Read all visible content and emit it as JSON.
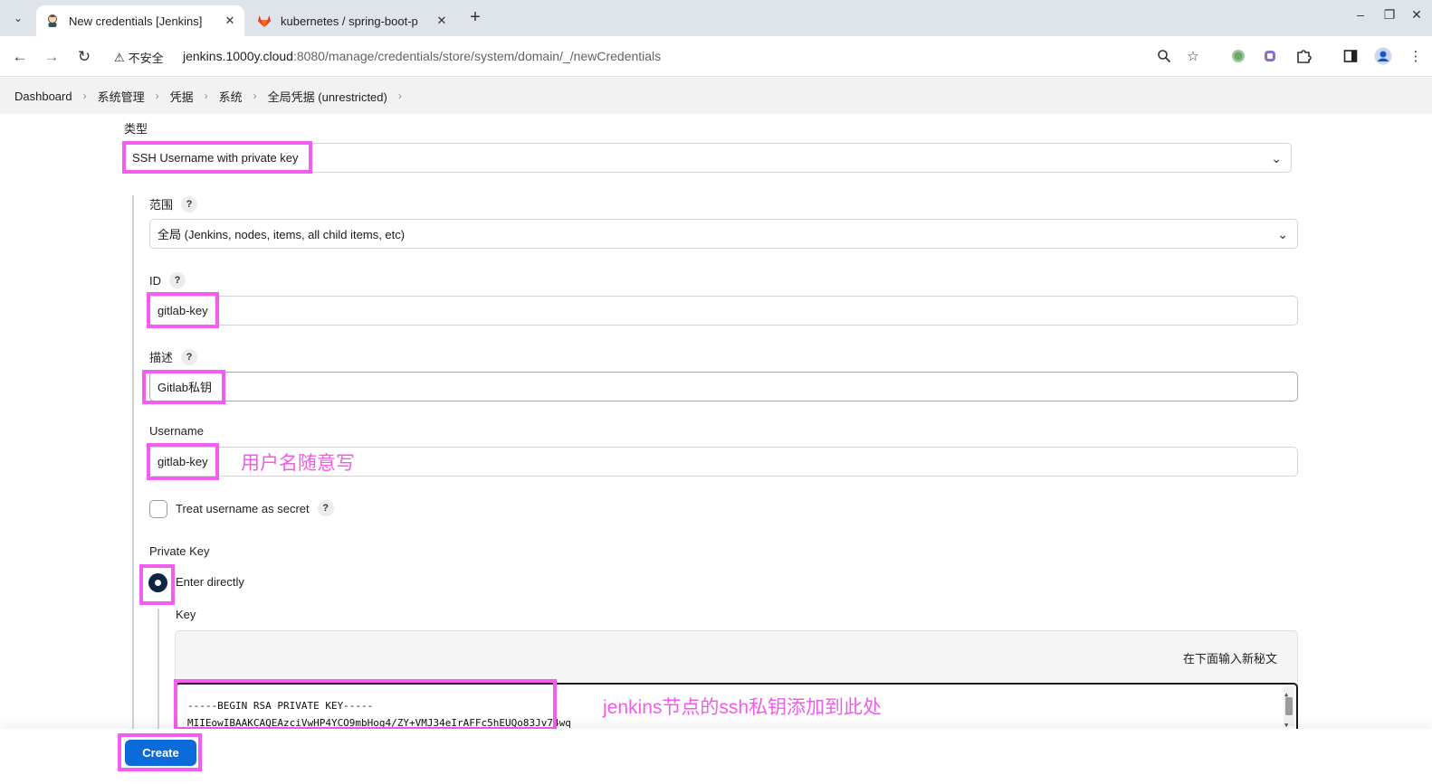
{
  "browser": {
    "tabs": [
      {
        "title": "New credentials [Jenkins]",
        "active": true
      },
      {
        "title": "kubernetes / spring-boot-p",
        "active": false
      }
    ],
    "insecure_label": "不安全",
    "url_host": "jenkins.1000y.cloud",
    "url_path": ":8080/manage/credentials/store/system/domain/_/newCredentials"
  },
  "breadcrumb": [
    "Dashboard",
    "系统管理",
    "凭据",
    "系统",
    "全局凭据 (unrestricted)"
  ],
  "form": {
    "kind_label": "类型",
    "kind_value": "SSH Username with private key",
    "scope_label": "范围",
    "scope_value": "全局 (Jenkins, nodes, items, all child items, etc)",
    "id_label": "ID",
    "id_value": "gitlab-key",
    "description_label": "描述",
    "description_value": "Gitlab私钥",
    "username_label": "Username",
    "username_value": "gitlab-key",
    "username_secret_label": "Treat username as secret",
    "private_key_label": "Private Key",
    "enter_directly_label": "Enter directly",
    "key_label": "Key",
    "key_hint": "在下面输入新秘文",
    "key_line1": "-----BEGIN RSA PRIVATE KEY-----",
    "key_line2": "MIIEowIBAAKCAQEAzciVwHP4YCO9mbHog4/ZY+VMJ34eIrAFFc5hEUQo83Jv74wq",
    "help": "?",
    "create_label": "Create"
  },
  "annotations": {
    "username_note": "用户名随意写",
    "key_note": "jenkins节点的ssh私钥添加到此处",
    "highlight_color": "#f55cf1"
  },
  "colors": {
    "primary_button": "#0b6bda",
    "radio_selected": "#0b2545"
  }
}
